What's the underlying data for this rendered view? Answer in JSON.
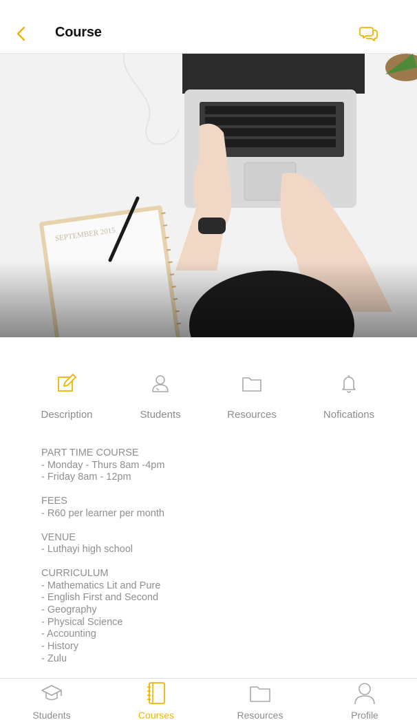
{
  "header": {
    "title": "Course",
    "back_icon": "chevron-left-icon",
    "chat_icon": "chat-bubbles-icon"
  },
  "colors": {
    "accent": "#f0b400",
    "text_muted": "#8f8f8f",
    "title": "#111111"
  },
  "hero": {
    "image": "laptop-desk-photo",
    "notebook_text": "SEPTEMBER 2015"
  },
  "tabs": [
    {
      "label": "Description",
      "icon": "edit-icon",
      "active": true
    },
    {
      "label": "Students",
      "icon": "user-icon",
      "active": false
    },
    {
      "label": "Resources",
      "icon": "folder-icon",
      "active": false
    },
    {
      "label": "Nofications",
      "icon": "bell-icon",
      "active": false
    }
  ],
  "description": {
    "sections": [
      {
        "lines": [
          "PART TIME COURSE",
          "- Monday - Thurs 8am -4pm",
          "- Friday 8am - 12pm"
        ]
      },
      {
        "lines": [
          "FEES",
          "- R60 per learner per month"
        ]
      },
      {
        "lines": [
          "VENUE",
          "- Luthayi high school"
        ]
      },
      {
        "lines": [
          "CURRICULUM",
          "- Mathematics Lit and Pure",
          "- English First and Second",
          "- Geography",
          "- Physical Science",
          "- Accounting",
          "- History",
          "- Zulu"
        ]
      }
    ]
  },
  "bottom_nav": [
    {
      "label": "Students",
      "icon": "graduation-cap-icon",
      "active": false
    },
    {
      "label": "Courses",
      "icon": "notebook-icon",
      "active": true
    },
    {
      "label": "Resources",
      "icon": "folder-icon",
      "active": false
    },
    {
      "label": "Profile",
      "icon": "person-icon",
      "active": false
    }
  ]
}
